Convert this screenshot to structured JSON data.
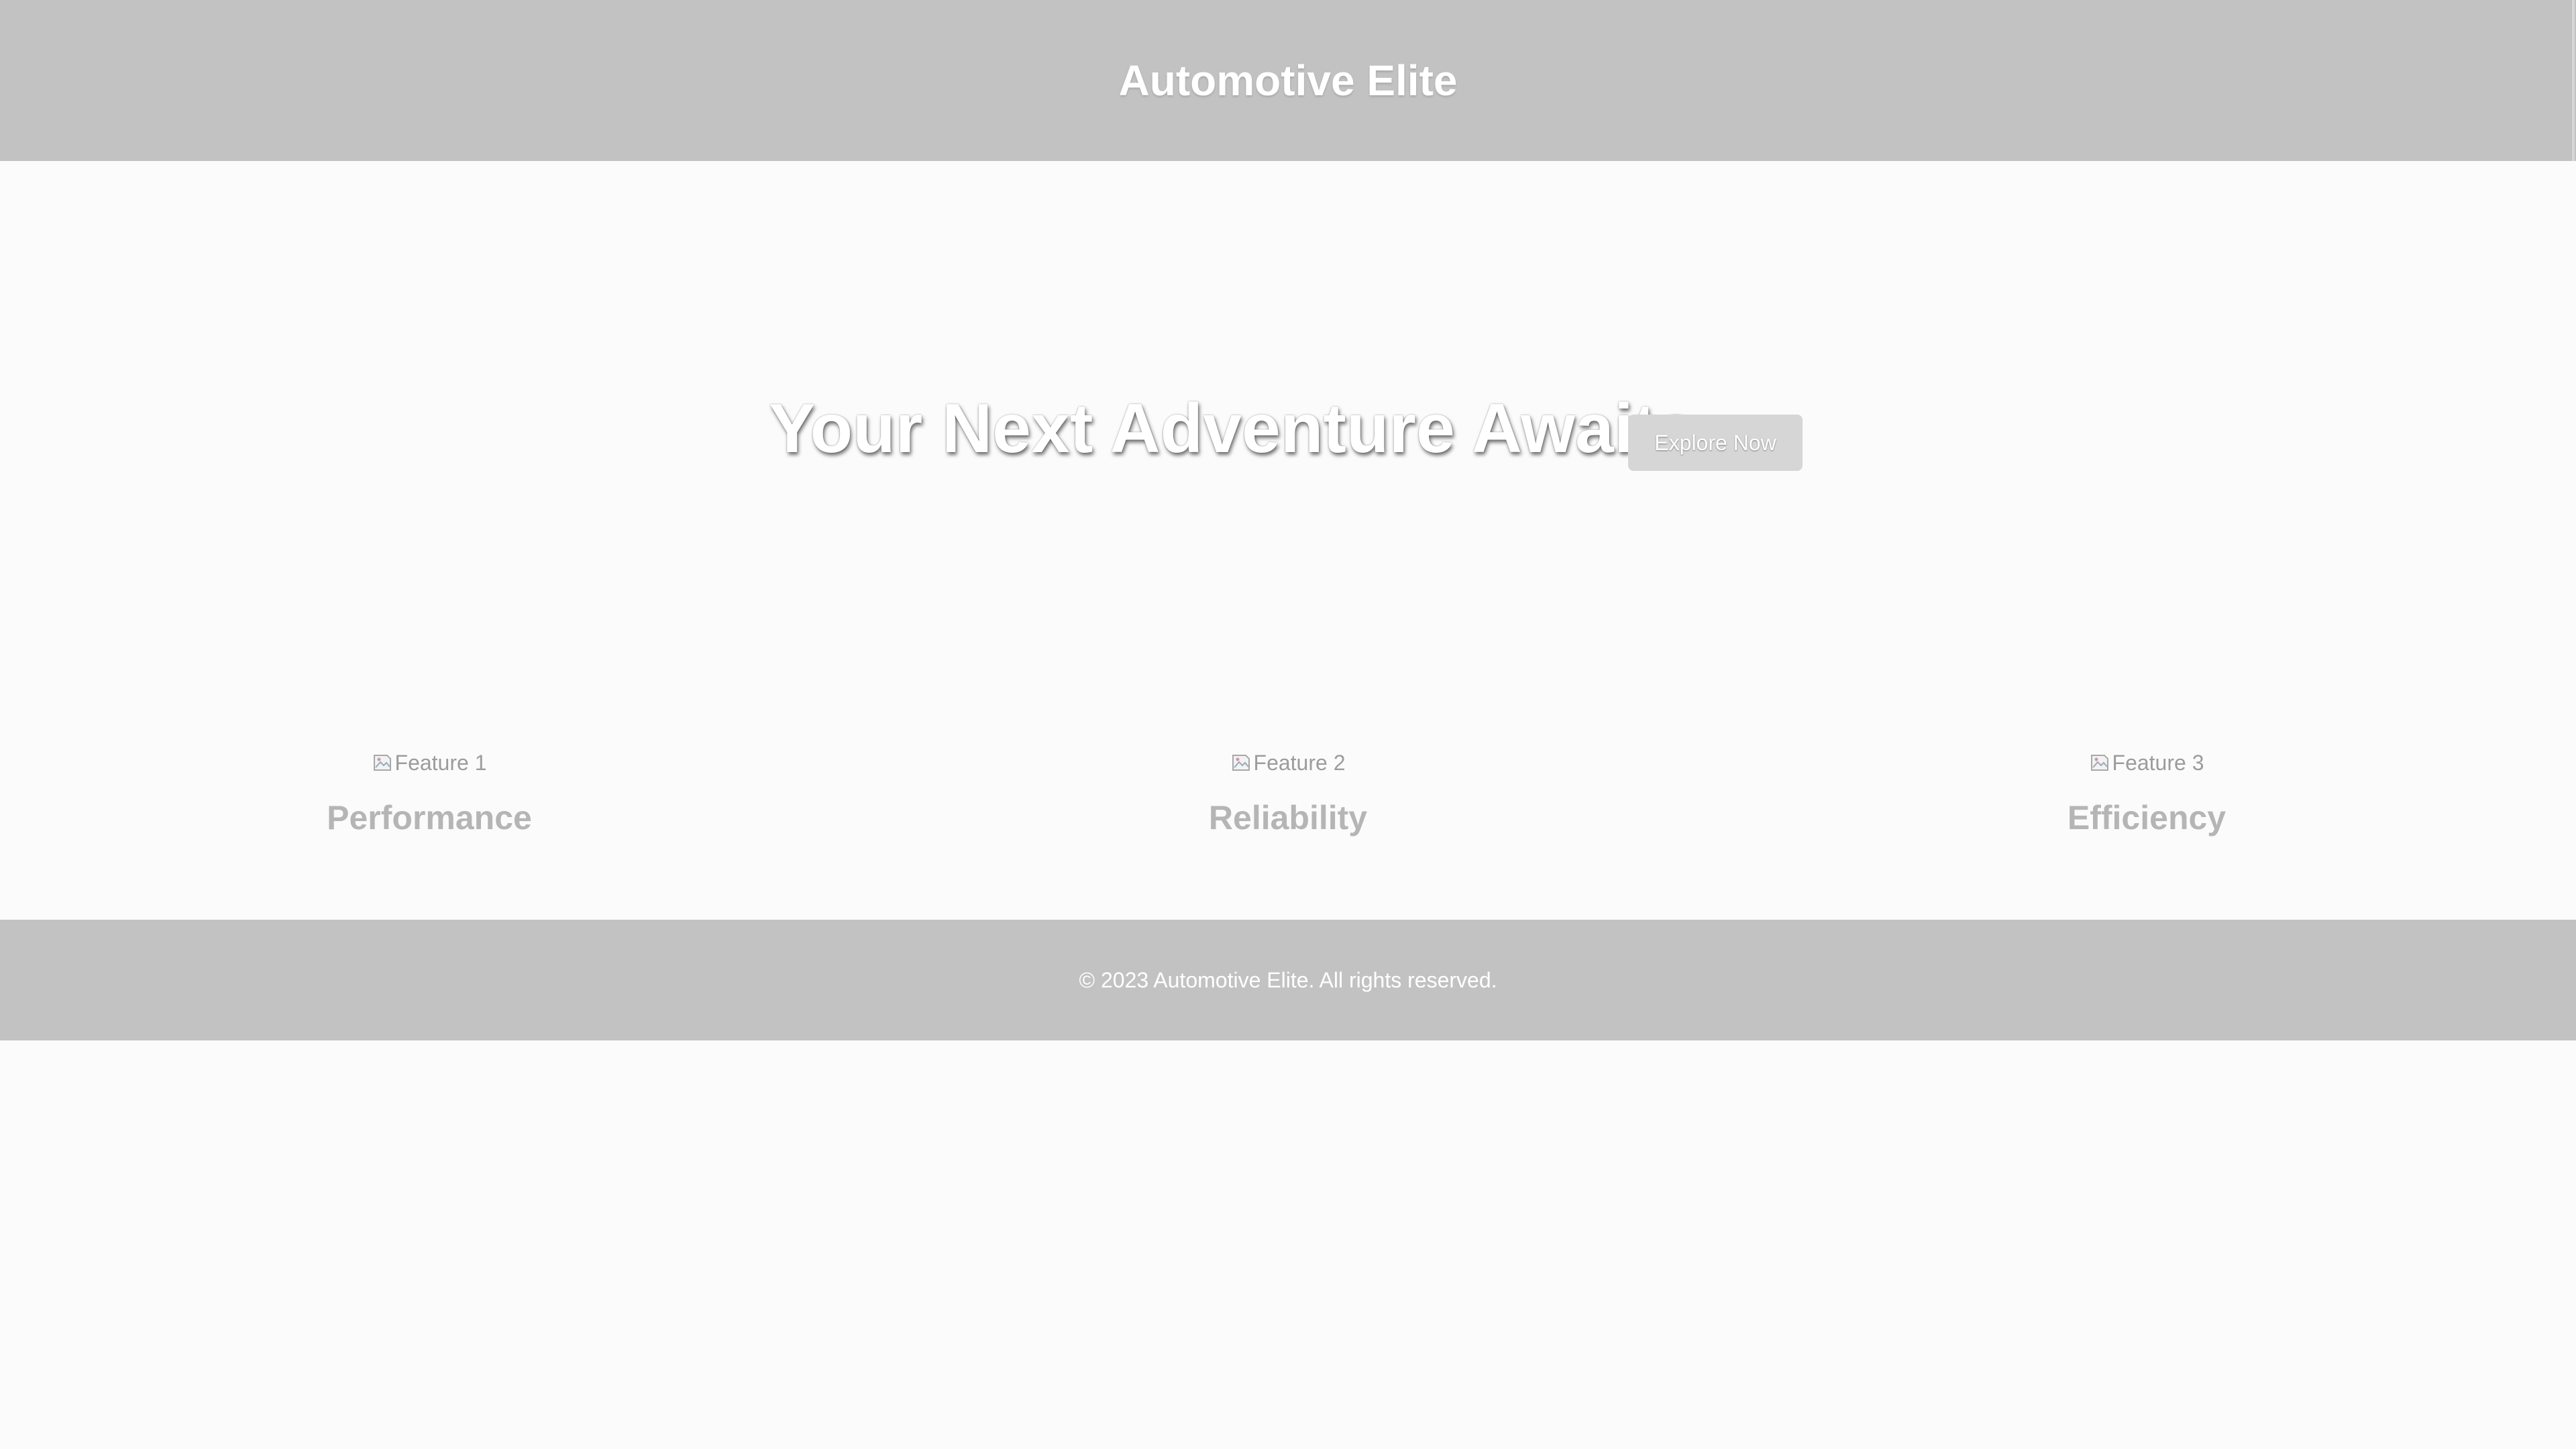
{
  "header": {
    "title": "Automotive Elite"
  },
  "hero": {
    "title": "Your Next Adventure Awaits",
    "button_label": "Explore Now"
  },
  "features": [
    {
      "image_alt": "Feature 1",
      "title": "Performance",
      "icon": "broken-image-icon"
    },
    {
      "image_alt": "Feature 2",
      "title": "Reliability",
      "icon": "broken-image-icon"
    },
    {
      "image_alt": "Feature 3",
      "title": "Efficiency",
      "icon": "broken-image-icon"
    }
  ],
  "footer": {
    "text": "© 2023 Automotive Elite. All rights reserved."
  },
  "colors": {
    "header_bg": "#c2c2c2",
    "page_bg": "#fbfbfb",
    "button_bg": "#d6d6d6",
    "text_light": "#ffffff",
    "feature_title": "#b5b5b5"
  }
}
